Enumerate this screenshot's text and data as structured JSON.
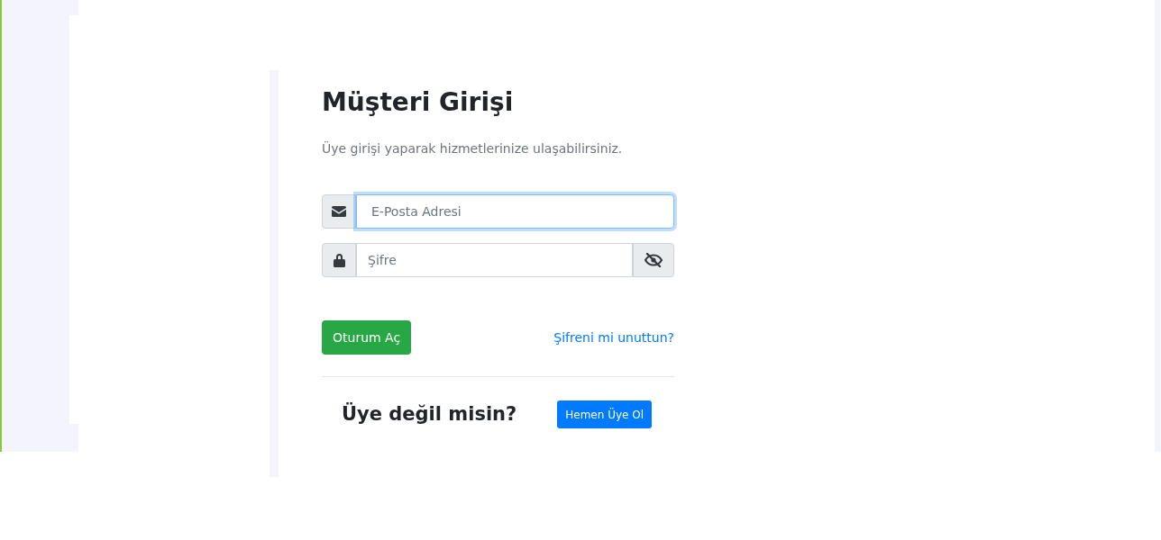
{
  "title": "Müşteri Girişi",
  "subtitle": "Üye girişi yaparak hizmetlerinize ulaşabilirsiniz.",
  "fields": [
    {
      "kind": "email",
      "placeholder": "E-Posta Adresi",
      "focused": true
    },
    {
      "kind": "password",
      "placeholder": "Şifre",
      "focused": false
    }
  ],
  "login_button": "Oturum Aç",
  "forgot_link": "Şifreni mi unuttun?",
  "signup_prompt": "Üye değil misin?",
  "signup_button": "Hemen Üye Ol"
}
